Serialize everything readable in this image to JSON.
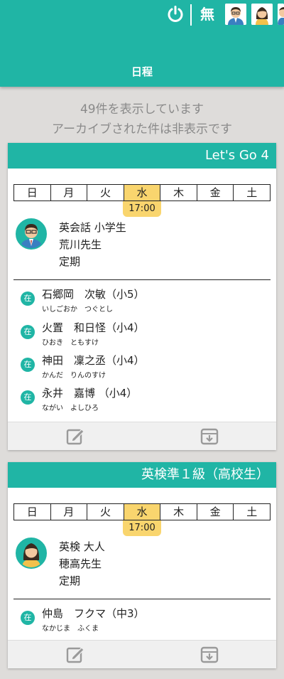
{
  "header": {
    "title": "日程",
    "mode_label": "無",
    "icons": [
      "power-icon",
      "teacher-avatar-icon",
      "female-teacher-avatar-icon",
      "user-avatar-icon"
    ]
  },
  "info": {
    "line1": "49件を表示しています",
    "line2": "アーカイブされた件は非表示です"
  },
  "days": [
    "日",
    "月",
    "火",
    "水",
    "木",
    "金",
    "土"
  ],
  "cards": [
    {
      "title": "Let's Go 4",
      "active_day": "水",
      "time": "17:00",
      "avatar": "male-teacher-avatar",
      "class_name": "英会話 小学生",
      "teacher": "荒川先生",
      "type": "定期",
      "students": [
        {
          "status": "在",
          "name": "石郷岡　次敏（小5）",
          "kana": "いしごおか　つぐとし"
        },
        {
          "status": "在",
          "name": "火置　和日怪（小4）",
          "kana": "ひおき　ともすけ"
        },
        {
          "status": "在",
          "name": "神田　凜之丞（小4）",
          "kana": "かんだ　りんのすけ"
        },
        {
          "status": "在",
          "name": "永井　嘉博 （小4）",
          "kana": "ながい　よしひろ"
        }
      ],
      "footer_icons": [
        "edit-icon",
        "archive-icon"
      ]
    },
    {
      "title": "英検準１級（高校生）",
      "active_day": "水",
      "time": "17:00",
      "avatar": "female-teacher-avatar",
      "class_name": "英検 大人",
      "teacher": "穂高先生",
      "type": "定期",
      "students": [
        {
          "status": "在",
          "name": "仲島　フクマ（中3）",
          "kana": "なかじま　ふくま"
        }
      ],
      "footer_icons": [
        "edit-icon",
        "archive-icon"
      ]
    }
  ],
  "colors": {
    "primary": "#20b5a5",
    "highlight": "#f9d56e",
    "background": "#dedcda"
  }
}
